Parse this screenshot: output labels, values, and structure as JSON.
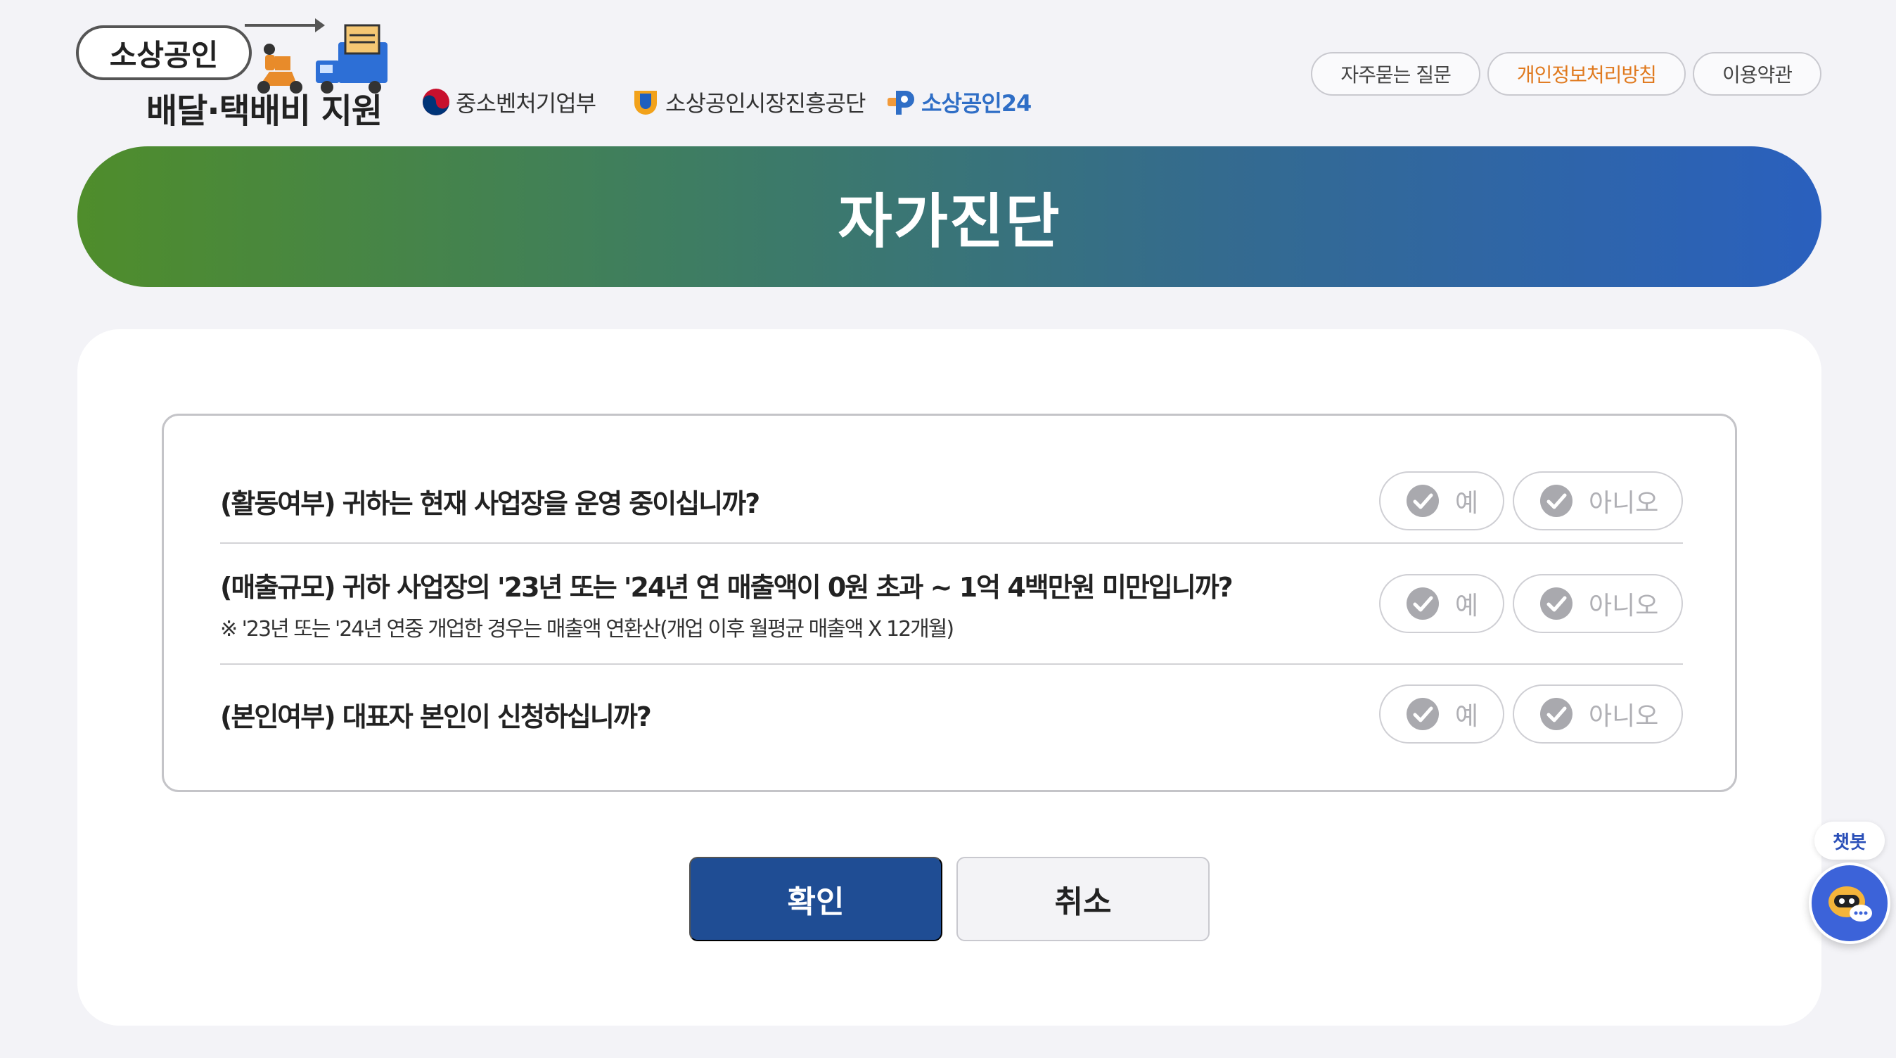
{
  "header": {
    "logo_main": "소상공인",
    "logo_sub": "배달·택배비 지원",
    "partners": [
      "중소벤처기업부",
      "소상공인시장진흥공단",
      "소상공인24"
    ],
    "links": [
      "자주묻는 질문",
      "개인정보처리방침",
      "이용약관"
    ]
  },
  "banner": {
    "title": "자가진단"
  },
  "questions": [
    {
      "text": "(활동여부) 귀하는 현재 사업장을 운영 중이십니까?",
      "note": "",
      "yes": "예",
      "no": "아니오"
    },
    {
      "text": "(매출규모) 귀하 사업장의 '23년 또는 '24년 연 매출액이 0원 초과 ~ 1억 4백만원 미만입니까?",
      "note": "※ '23년 또는 '24년 연중 개업한 경우는 매출액 연환산(개업 이후 월평균 매출액 X 12개월)",
      "yes": "예",
      "no": "아니오"
    },
    {
      "text": "(본인여부) 대표자 본인이 신청하십니까?",
      "note": "",
      "yes": "예",
      "no": "아니오"
    }
  ],
  "buttons": {
    "confirm": "확인",
    "cancel": "취소"
  },
  "chatbot": {
    "label": "챗봇"
  },
  "colors": {
    "accent": "#e07a1f",
    "primary": "#1f4d94",
    "gradient_start": "#4f8d2b",
    "gradient_end": "#2a60be"
  },
  "icons": [
    "check-circle-icon",
    "chatbot-icon",
    "taegeuk-icon",
    "semas-icon",
    "sbiz24-icon",
    "delivery-truck-icon",
    "scooter-rider-icon"
  ]
}
